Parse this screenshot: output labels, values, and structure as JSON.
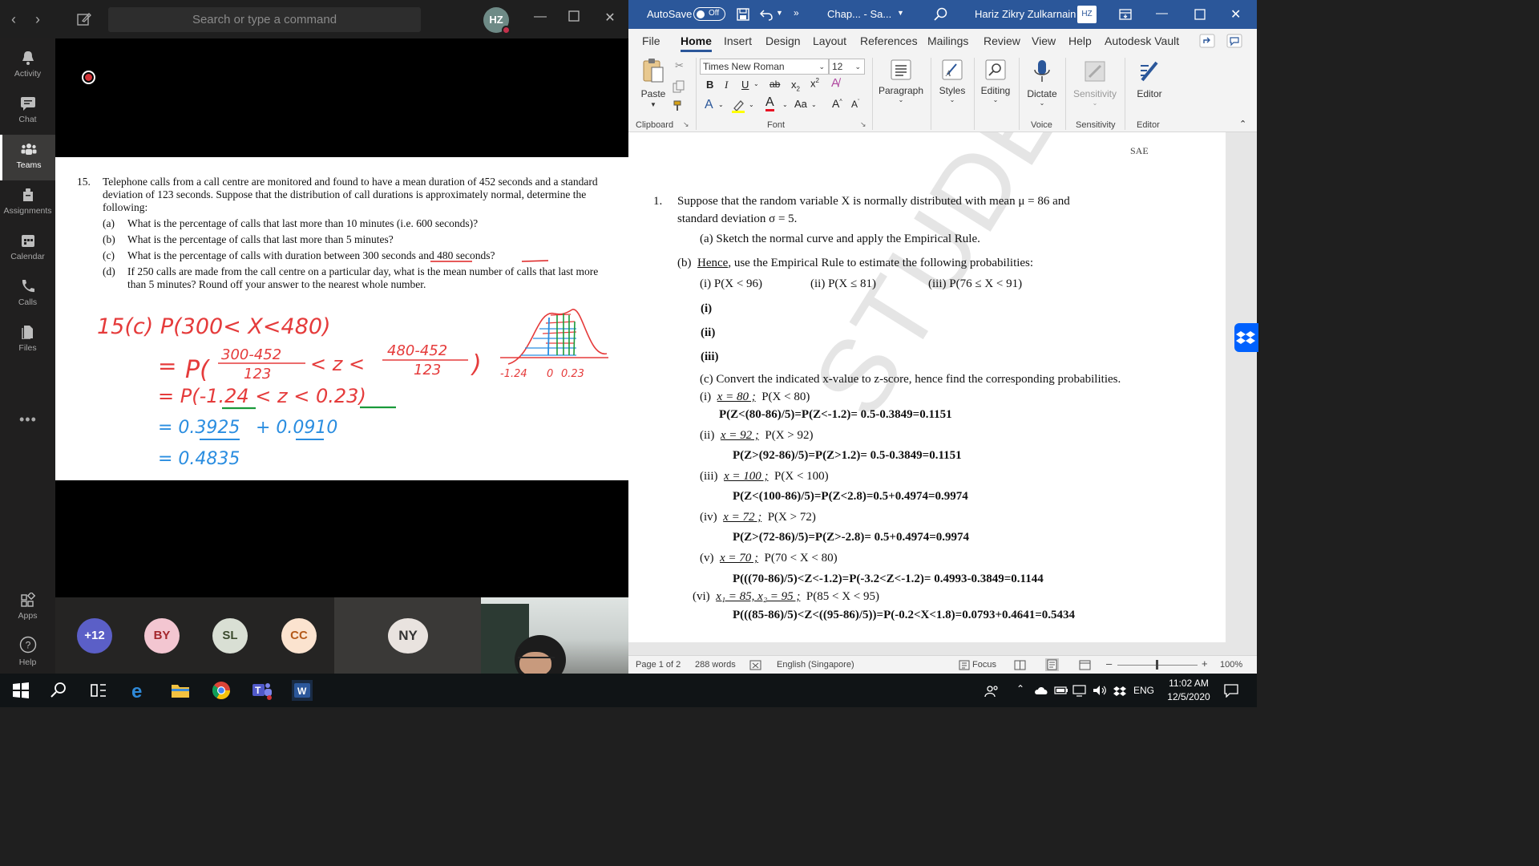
{
  "teams": {
    "search_placeholder": "Search or type a command",
    "avatar_initials": "HZ",
    "rail": [
      {
        "label": "Activity",
        "icon": "bell-icon"
      },
      {
        "label": "Chat",
        "icon": "chat-icon"
      },
      {
        "label": "Teams",
        "icon": "teams-icon",
        "active": true
      },
      {
        "label": "Assignments",
        "icon": "assignments-icon"
      },
      {
        "label": "Calendar",
        "icon": "calendar-icon"
      },
      {
        "label": "Calls",
        "icon": "phone-icon"
      },
      {
        "label": "Files",
        "icon": "files-icon"
      },
      {
        "label": "Apps",
        "icon": "apps-icon"
      },
      {
        "label": "Help",
        "icon": "help-icon"
      }
    ],
    "more_label": "•••",
    "participants": {
      "overflow": "+12",
      "bubbles": [
        {
          "initials": "BY",
          "color": "#f3c6d1",
          "text_color": "#a4262c"
        },
        {
          "initials": "SL",
          "color": "#d9dfd4",
          "text_color": "#3b4a2d"
        },
        {
          "initials": "CC",
          "color": "#fbe3cf",
          "text_color": "#b55a1a"
        }
      ],
      "tile_name": "NY"
    }
  },
  "shared_doc": {
    "q_number": "15.",
    "q_text": "Telephone calls from a call centre are monitored and found to have a mean duration of 452 seconds and a standard deviation of 123 seconds. Suppose that the distribution of call durations is approximately normal, determine the following:",
    "parts": [
      {
        "label": "(a)",
        "text": "What is the percentage of calls that last more than 10 minutes (i.e. 600 seconds)?"
      },
      {
        "label": "(b)",
        "text": "What is the percentage of calls that last more than 5 minutes?"
      },
      {
        "label": "(c)",
        "text": "What is the percentage of calls with duration between 300 seconds and 480 seconds?"
      },
      {
        "label": "(d)",
        "text": "If 250 calls are made from the call centre on a particular day, what is the mean number of calls that last more than 5 minutes? Round off your answer to the nearest whole number."
      }
    ],
    "ink": {
      "line1": "15(c)  P(300< X<480)",
      "frac1_num": "300-452",
      "frac1_den": "123",
      "frac2_num": "480-452",
      "frac2_den": "123",
      "line3": "= P(-1.24 < z < 0.23)",
      "line4a": "= 0.3925",
      "line4b": "+ 0.0910",
      "line5": "= 0.4835",
      "axis_left": "-1.24",
      "axis_mid": "0",
      "axis_right": "0.23"
    }
  },
  "word": {
    "autosave_label": "AutoSave",
    "autosave_state": "Off",
    "doc_title": "Chap... - Sa...",
    "user_name": "Hariz Zikry Zulkarnain",
    "user_initials": "HZ",
    "menus": [
      "File",
      "Home",
      "Insert",
      "Design",
      "Layout",
      "References",
      "Mailings",
      "Review",
      "View",
      "Help",
      "Autodesk Vault"
    ],
    "active_menu": "Home",
    "ribbon": {
      "paste": "Paste",
      "font_name": "Times New Roman",
      "font_size": "12",
      "paragraph": "Paragraph",
      "styles": "Styles",
      "editing": "Editing",
      "dictate": "Dictate",
      "sensitivity": "Sensitivity",
      "editor": "Editor",
      "groups": [
        "Clipboard",
        "Font",
        "Voice",
        "Sensitivity",
        "Editor"
      ]
    },
    "page": {
      "header": "SAE",
      "watermark": "STUDENT COPY",
      "q1_num": "1.",
      "q1_line1": "Suppose that the random variable X is normally distributed with mean μ = 86 and",
      "q1_line2": "standard deviation σ = 5.",
      "a": "(a)  Sketch the normal curve and apply the Empirical Rule.",
      "b_label": "(b)",
      "b_hence": "Hence",
      "b_rest": ", use the Empirical Rule to estimate the following probabilities:",
      "b_i": "(i)  P(X < 96)",
      "b_ii": "(ii)  P(X ≤ 81)",
      "b_iii": "(iii)  P(76 ≤ X < 91)",
      "sub_i": "(i)",
      "sub_ii": "(ii)",
      "sub_iii": "(iii)",
      "c": "(c)  Convert the indicated x-value to z-score, hence find the corresponding probabilities.",
      "items": [
        {
          "label": "(i)",
          "x": "x = 80 ;",
          "prob": "P(X < 80)",
          "answer": "P(Z<(80-86)/5)=P(Z<-1.2)= 0.5-0.3849=0.1151"
        },
        {
          "label": "(ii)",
          "x": "x = 92 ;",
          "prob": "P(X > 92)",
          "answer": "P(Z>(92-86)/5)=P(Z>1.2)= 0.5-0.3849=0.1151"
        },
        {
          "label": "(iii)",
          "x": "x = 100 ;",
          "prob": "P(X < 100)",
          "answer": "P(Z<(100-86)/5)=P(Z<2.8)=0.5+0.4974=0.9974"
        },
        {
          "label": "(iv)",
          "x": "x = 72 ;",
          "prob": "P(X > 72)",
          "answer": "P(Z>(72-86)/5)=P(Z>-2.8)= 0.5+0.4974=0.9974"
        },
        {
          "label": "(v)",
          "x": "x = 70 ;",
          "prob": "P(70 < X < 80)",
          "answer": "P(((70-86)/5)<Z<-1.2)=P(-3.2<Z<-1.2)= 0.4993-0.3849=0.1144"
        },
        {
          "label": "(vi)",
          "x": "x₁ = 85, x₂ = 95 ;",
          "prob": "P(85 < X < 95)",
          "answer": "P(((85-86)/5)<Z<((95-86)/5))=P(-0.2<X<1.8)=0.0793+0.4641=0.5434"
        }
      ]
    },
    "status": {
      "page": "Page 1 of 2",
      "words": "288 words",
      "language": "English (Singapore)",
      "focus": "Focus",
      "zoom": "100%"
    }
  },
  "taskbar": {
    "lang": "ENG",
    "time": "11:02 AM",
    "date": "12/5/2020"
  }
}
